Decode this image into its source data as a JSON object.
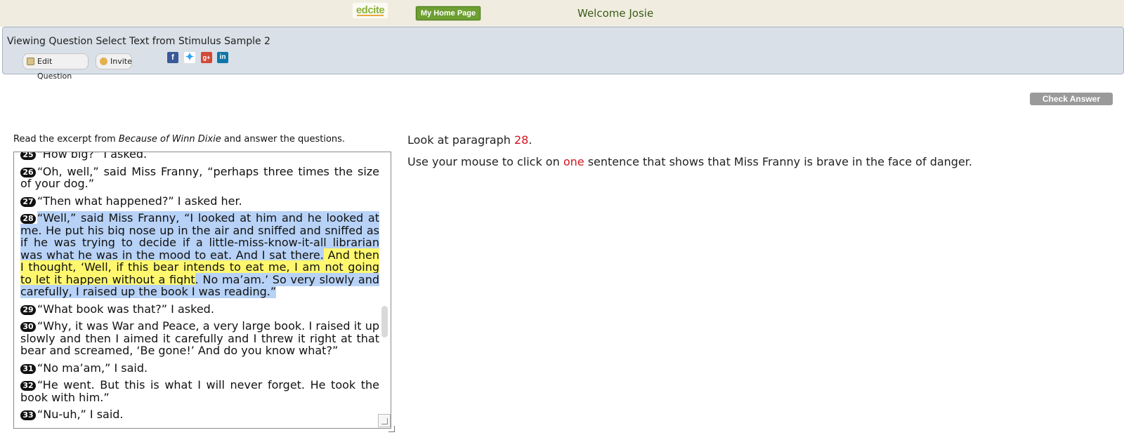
{
  "topbar": {
    "logo_text": "edcite",
    "home_button": "My Home Page",
    "welcome": "Welcome Josie"
  },
  "header": {
    "title": "Viewing Question Select Text from Stimulus Sample 2",
    "edit_button": "Edit Question",
    "invite_button": "Invite",
    "social_icons": [
      "facebook-icon",
      "twitter-icon",
      "google-plus-icon",
      "linkedin-icon"
    ]
  },
  "actions": {
    "check_answer": "Check Answer"
  },
  "passage": {
    "intro_before": "Read the excerpt from ",
    "intro_title": "Because of Winn Dixie",
    "intro_after": " and answer the questions.",
    "partial_top": "“How big?” I asked.",
    "p26": "“Oh, well,” said Miss Franny, “perhaps three times the size of your dog.”",
    "p27": "“Then what happened?” I asked her.",
    "p28_s1": "“Well,” said Miss Franny, “I looked at him and he looked at me. He put his big nose up in the air and sniffed and sniffed as if he was trying to decide if a little-miss-know-it-all librarian was what he was in the mood to eat",
    "p28_s2": ". And I sat there.",
    "p28_s3": " And then I thought, ‘Well, if this bear intends to eat me, I am not going to let it happen without a fight",
    "p28_s4": ". No ma’am.’ So very slowly and carefully, I raised up the book I was reading.”",
    "p29": "“What book was that?” I asked.",
    "p30": "“Why, it was War and Peace, a very large book. I raised it up slowly and then I aimed it carefully and I threw it right at that bear and screamed, ‘Be gone!’ And do you know what?”",
    "p31": "“No ma’am,” I said.",
    "p32": "“He went. But this is what I will never forget. He took the book with him.”",
    "p33": "“Nu-uh,” I said.",
    "numbers": {
      "n25": "25",
      "n26": "26",
      "n27": "27",
      "n28": "28",
      "n29": "29",
      "n30": "30",
      "n31": "31",
      "n32": "32",
      "n33": "33"
    },
    "highlight_colors": {
      "blue": "#b7d2f6",
      "yellow": "#fff86e"
    }
  },
  "question": {
    "line1_prefix": "Look at paragraph ",
    "line1_num": "28",
    "line1_suffix": ".",
    "line2_prefix": "Use your mouse to click on ",
    "line2_emph": "one",
    "line2_suffix": " sentence that shows that Miss Franny is brave in the face of danger."
  }
}
